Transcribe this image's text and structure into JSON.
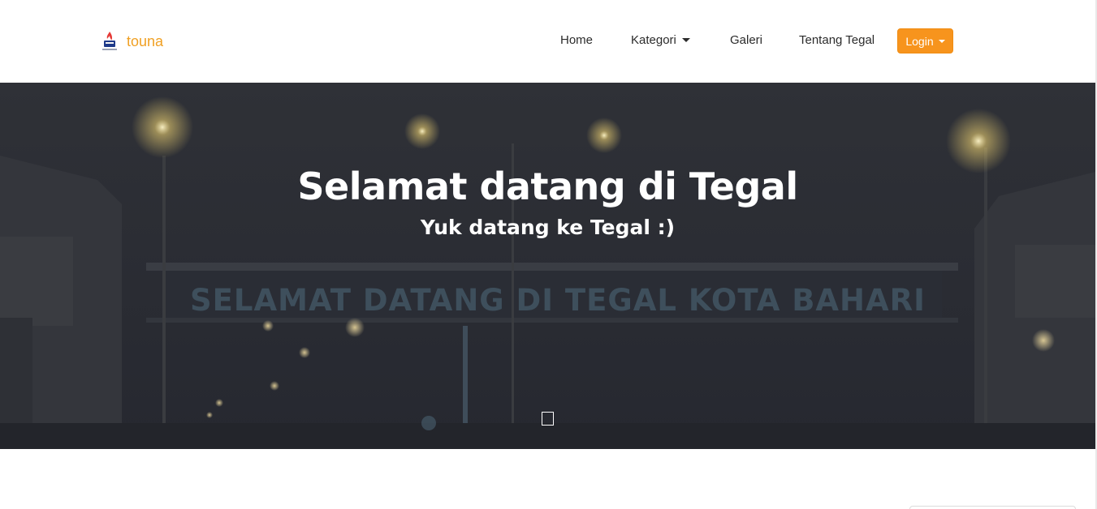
{
  "brand": {
    "name": "touna"
  },
  "nav": {
    "home": "Home",
    "kategori": "Kategori",
    "galeri": "Galeri",
    "tentang": "Tentang Tegal",
    "login": "Login"
  },
  "hero": {
    "title": "Selamat datang di Tegal",
    "subtitle": "Yuk datang ke Tegal :)",
    "sign": "SELAMAT DATANG DI TEGAL KOTA BAHARI"
  },
  "colors": {
    "accent": "#f7941d",
    "brand_text": "#f0a023",
    "hero_overlay": "#2c2e35"
  },
  "icons": {
    "logo": "city-logo-icon",
    "scroll": "scroll-down-icon"
  }
}
